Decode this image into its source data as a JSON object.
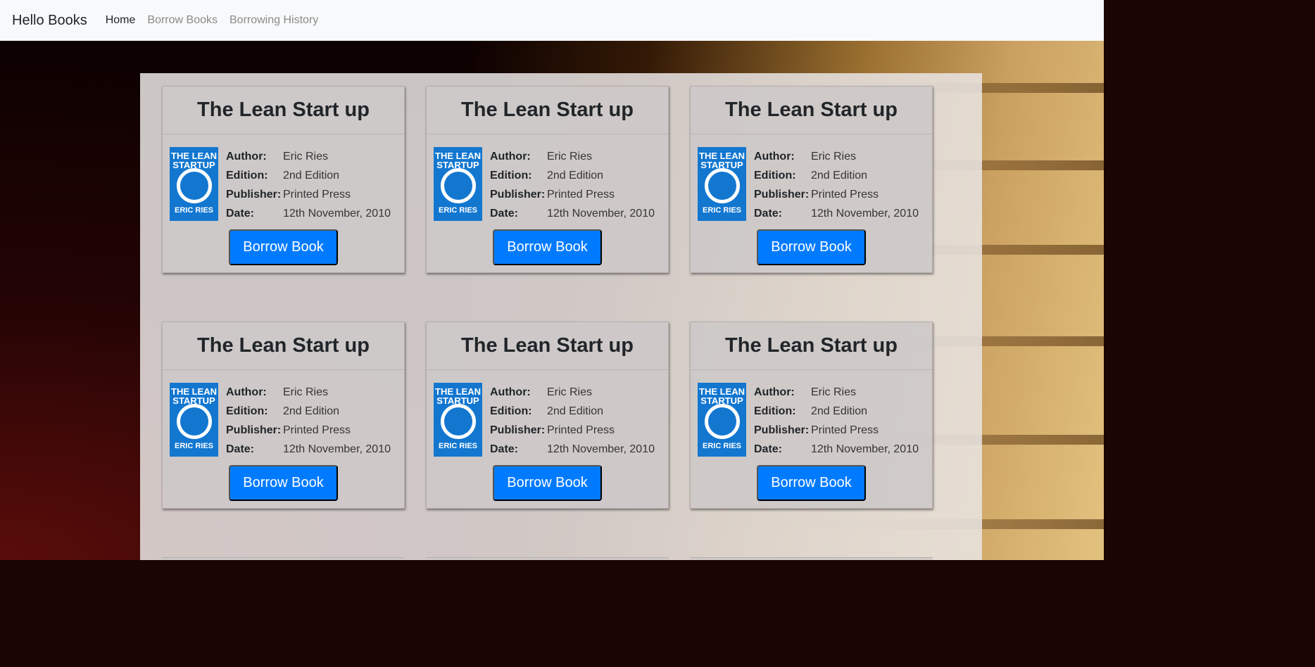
{
  "navbar": {
    "brand": "Hello Books",
    "links": [
      {
        "label": "Home",
        "active": true
      },
      {
        "label": "Borrow Books",
        "active": false
      },
      {
        "label": "Borrowing History",
        "active": false
      }
    ]
  },
  "book_cover": {
    "top_text": "THE LEAN STARTUP",
    "bottom_text": "ERIC RIES"
  },
  "field_labels": {
    "author": "Author:",
    "edition": "Edition:",
    "publisher": "Publisher:",
    "date": "Date:"
  },
  "books": [
    {
      "title": "The Lean Start up",
      "author": "Eric Ries",
      "edition": "2nd Edition",
      "publisher": "Printed Press",
      "date": "12th November, 2010",
      "button": "Borrow Book"
    },
    {
      "title": "The Lean Start up",
      "author": "Eric Ries",
      "edition": "2nd Edition",
      "publisher": "Printed Press",
      "date": "12th November, 2010",
      "button": "Borrow Book"
    },
    {
      "title": "The Lean Start up",
      "author": "Eric Ries",
      "edition": "2nd Edition",
      "publisher": "Printed Press",
      "date": "12th November, 2010",
      "button": "Borrow Book"
    },
    {
      "title": "The Lean Start up",
      "author": "Eric Ries",
      "edition": "2nd Edition",
      "publisher": "Printed Press",
      "date": "12th November, 2010",
      "button": "Borrow Book"
    },
    {
      "title": "The Lean Start up",
      "author": "Eric Ries",
      "edition": "2nd Edition",
      "publisher": "Printed Press",
      "date": "12th November, 2010",
      "button": "Borrow Book"
    },
    {
      "title": "The Lean Start up",
      "author": "Eric Ries",
      "edition": "2nd Edition",
      "publisher": "Printed Press",
      "date": "12th November, 2010",
      "button": "Borrow Book"
    }
  ],
  "colors": {
    "primary_button": "#007bff",
    "navbar_bg": "#f8f9fa"
  }
}
